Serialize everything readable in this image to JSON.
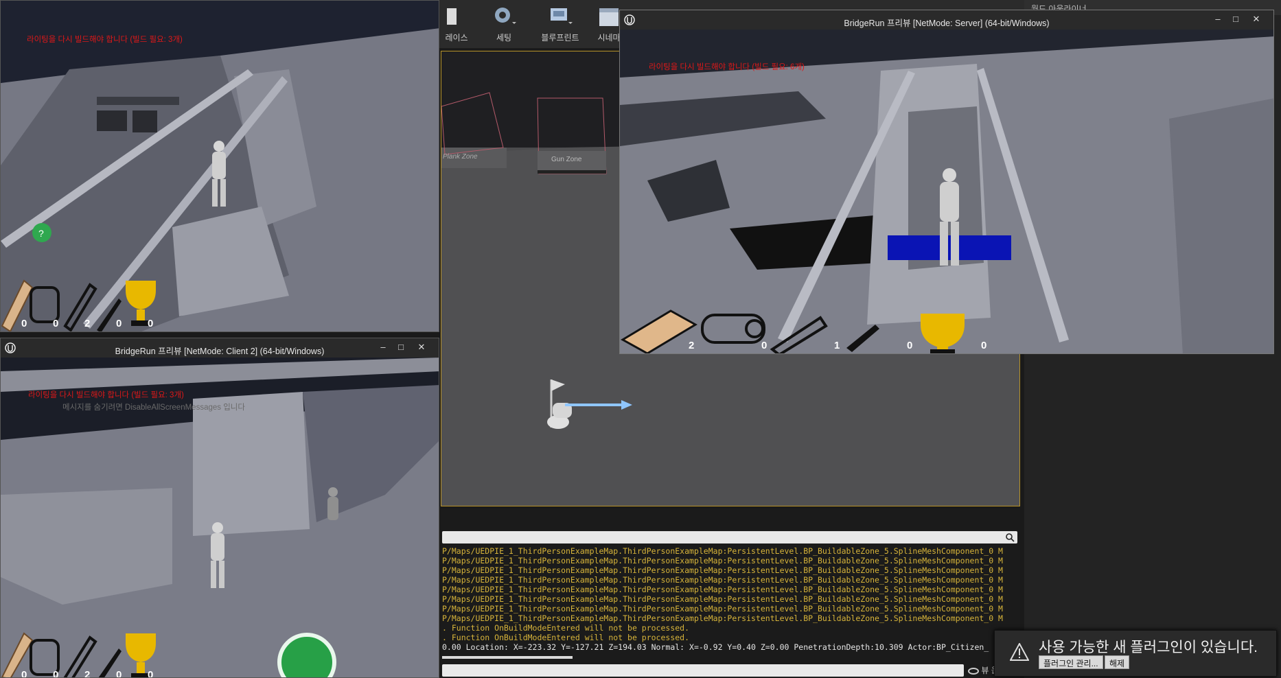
{
  "toolbar": {
    "items": [
      {
        "label": "레이스"
      },
      {
        "label": "세팅"
      },
      {
        "label": "블루프린트"
      },
      {
        "label": "시네마"
      }
    ]
  },
  "outliner": {
    "title": "월드 아웃라이너"
  },
  "level_viewport": {
    "zone_labels": [
      "Plank Zone",
      "Gun Zone"
    ]
  },
  "client1": {
    "warning": "라이팅을 다시 빌드해야 합니다 (빌드 필요: 3개)",
    "hud_counts": [
      "0",
      "0",
      "2",
      "0",
      "0"
    ]
  },
  "client2": {
    "title": "BridgeRun 프리뷰 [NetMode: Client 2]  (64-bit/Windows)",
    "warning": "라이팅을 다시 빌드해야 합니다 (빌드 필요: 3개)",
    "sub_message": "메시지를 숨기려면 DisableAllScreenMessages 입니다",
    "hud_counts": [
      "0",
      "0",
      "2",
      "0",
      "0"
    ]
  },
  "server": {
    "title": "BridgeRun 프리뷰 [NetMode: Server]  (64-bit/Windows)",
    "warning": "라이팅을 다시 빌드해야 합니다 (빌드 필요: 6개)",
    "hud_counts": [
      "2",
      "0",
      "1",
      "0",
      "0"
    ]
  },
  "window_buttons": {
    "minimize": "–",
    "maximize": "□",
    "close": "✕"
  },
  "output_log": {
    "lines": [
      "P/Maps/UEDPIE_1_ThirdPersonExampleMap.ThirdPersonExampleMap:PersistentLevel.BP_BuildableZone_5.SplineMeshComponent_0 M",
      "P/Maps/UEDPIE_1_ThirdPersonExampleMap.ThirdPersonExampleMap:PersistentLevel.BP_BuildableZone_5.SplineMeshComponent_0 M",
      "P/Maps/UEDPIE_1_ThirdPersonExampleMap.ThirdPersonExampleMap:PersistentLevel.BP_BuildableZone_5.SplineMeshComponent_0 M",
      "P/Maps/UEDPIE_1_ThirdPersonExampleMap.ThirdPersonExampleMap:PersistentLevel.BP_BuildableZone_5.SplineMeshComponent_0 M",
      "P/Maps/UEDPIE_1_ThirdPersonExampleMap.ThirdPersonExampleMap:PersistentLevel.BP_BuildableZone_5.SplineMeshComponent_0 M",
      "P/Maps/UEDPIE_1_ThirdPersonExampleMap.ThirdPersonExampleMap:PersistentLevel.BP_BuildableZone_5.SplineMeshComponent_0 M",
      "P/Maps/UEDPIE_1_ThirdPersonExampleMap.ThirdPersonExampleMap:PersistentLevel.BP_BuildableZone_5.SplineMeshComponent_0 M",
      "P/Maps/UEDPIE_1_ThirdPersonExampleMap.ThirdPersonExampleMap:PersistentLevel.BP_BuildableZone_5.SplineMeshComponent_0 M",
      ". Function OnBuildModeEntered will not be processed.",
      ". Function OnBuildModeEntered will not be processed.",
      "0.00 Location: X=-223.32 Y=-127.21 Z=194.03 Normal: X=-0.92 Y=0.40 Z=0.00 PenetrationDepth:10.309 Actor:BP_Citizen_"
    ],
    "view_options_label": "뷰 옵션"
  },
  "toast": {
    "message": "사용 가능한 새 플러그인이 있습니다.",
    "manage_label": "플러그인 관리...",
    "dismiss_label": "해제"
  },
  "colors": {
    "warning": "#e01818",
    "log_text": "#d7b43a",
    "selection_border": "#b8942a",
    "trophy": "#e8b800"
  }
}
